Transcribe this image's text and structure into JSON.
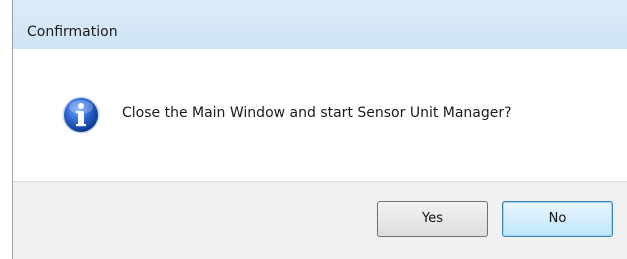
{
  "dialog": {
    "title": "Confirmation",
    "message": "Close the Main Window and start Sensor Unit Manager?",
    "icon": "info-icon",
    "buttons": {
      "yes_label": "Yes",
      "no_label": "No",
      "default": "No"
    }
  },
  "colors": {
    "titlebar": "#d6e8f7",
    "footer": "#f0f0f0",
    "icon_blue": "#1f5fbf",
    "default_button_border": "#3c7fb1"
  }
}
